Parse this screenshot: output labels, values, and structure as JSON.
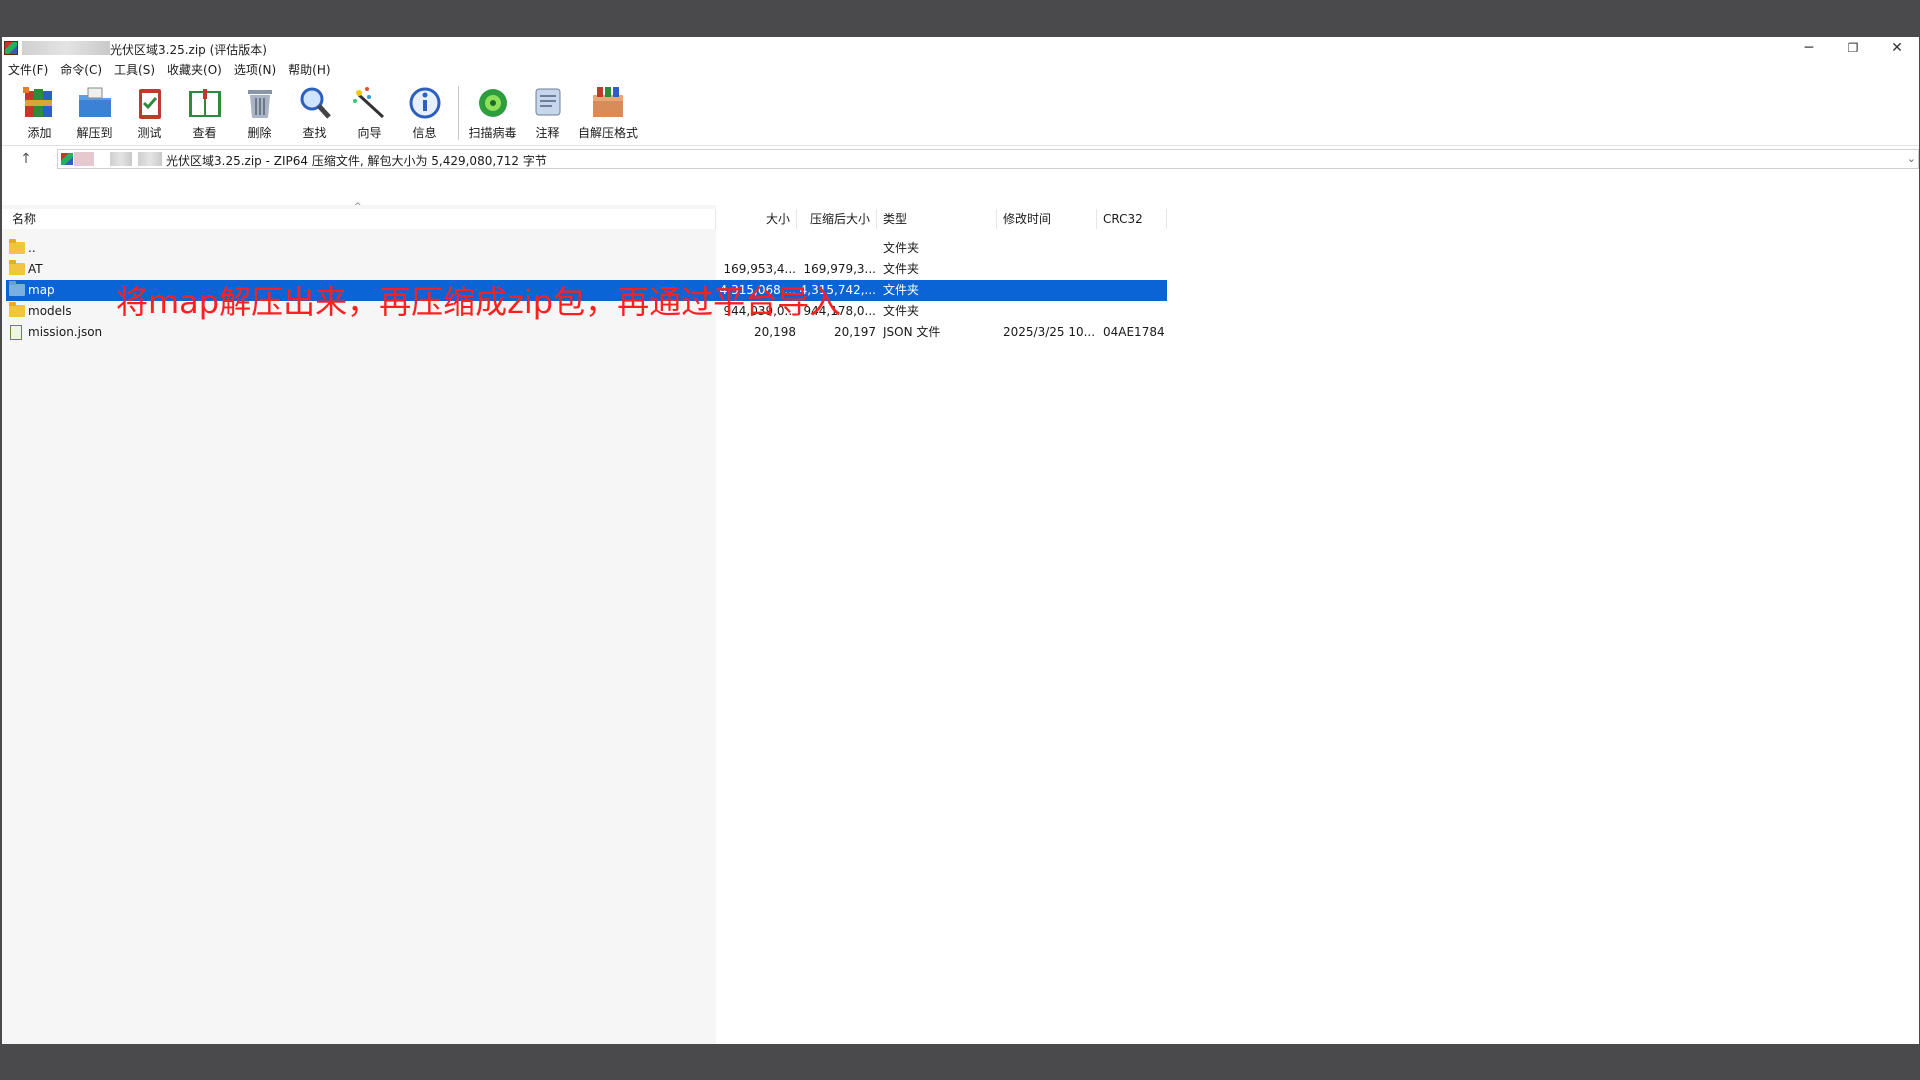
{
  "window": {
    "title": "光伏区域3.25.zip (评估版本)",
    "controls": {
      "minimize": "─",
      "maximize": "❐",
      "close": "✕"
    }
  },
  "menu": [
    "文件(F)",
    "命令(C)",
    "工具(S)",
    "收藏夹(O)",
    "选项(N)",
    "帮助(H)"
  ],
  "toolbar": {
    "items": [
      {
        "label": "添加",
        "icon": "add-archive-icon"
      },
      {
        "label": "解压到",
        "icon": "extract-folder-icon"
      },
      {
        "label": "测试",
        "icon": "test-clipboard-icon"
      },
      {
        "label": "查看",
        "icon": "view-book-icon"
      },
      {
        "label": "删除",
        "icon": "trash-icon"
      },
      {
        "label": "查找",
        "icon": "magnifier-icon"
      },
      {
        "label": "向导",
        "icon": "wizard-wand-icon"
      },
      {
        "label": "信息",
        "icon": "info-icon"
      }
    ],
    "items2": [
      {
        "label": "扫描病毒",
        "icon": "virus-scan-icon"
      },
      {
        "label": "注释",
        "icon": "comment-icon"
      },
      {
        "label": "自解压格式",
        "icon": "sfx-box-icon"
      }
    ]
  },
  "address": {
    "text": "光伏区域3.25.zip - ZIP64 压缩文件, 解包大小为 5,429,080,712 字节"
  },
  "columns": {
    "name": "名称",
    "size": "大小",
    "packed": "压缩后大小",
    "type": "类型",
    "modified": "修改时间",
    "crc": "CRC32"
  },
  "rows": [
    {
      "name": "..",
      "size": "",
      "packed": "",
      "type": "文件夹",
      "modified": "",
      "crc": "",
      "kind": "folder"
    },
    {
      "name": "AT",
      "size": "169,953,4...",
      "packed": "169,979,3...",
      "type": "文件夹",
      "modified": "",
      "crc": "",
      "kind": "folder"
    },
    {
      "name": "map",
      "size": "4,315,068,...",
      "packed": "4,315,742,...",
      "type": "文件夹",
      "modified": "",
      "crc": "",
      "kind": "folder"
    },
    {
      "name": "models",
      "size": "944,039,0...",
      "packed": "944,178,0...",
      "type": "文件夹",
      "modified": "",
      "crc": "",
      "kind": "folder"
    },
    {
      "name": "mission.json",
      "size": "20,198",
      "packed": "20,197",
      "type": "JSON 文件",
      "modified": "2025/3/25 10...",
      "crc": "04AE1784",
      "kind": "file"
    }
  ],
  "selected_row": 2,
  "annotation": "将map解压出来，再压缩成zip包，再通过平台导入",
  "colors": {
    "selection": "#0a64d6",
    "annotation": "#ff1f1f",
    "desktop": "#4a4a4d"
  }
}
